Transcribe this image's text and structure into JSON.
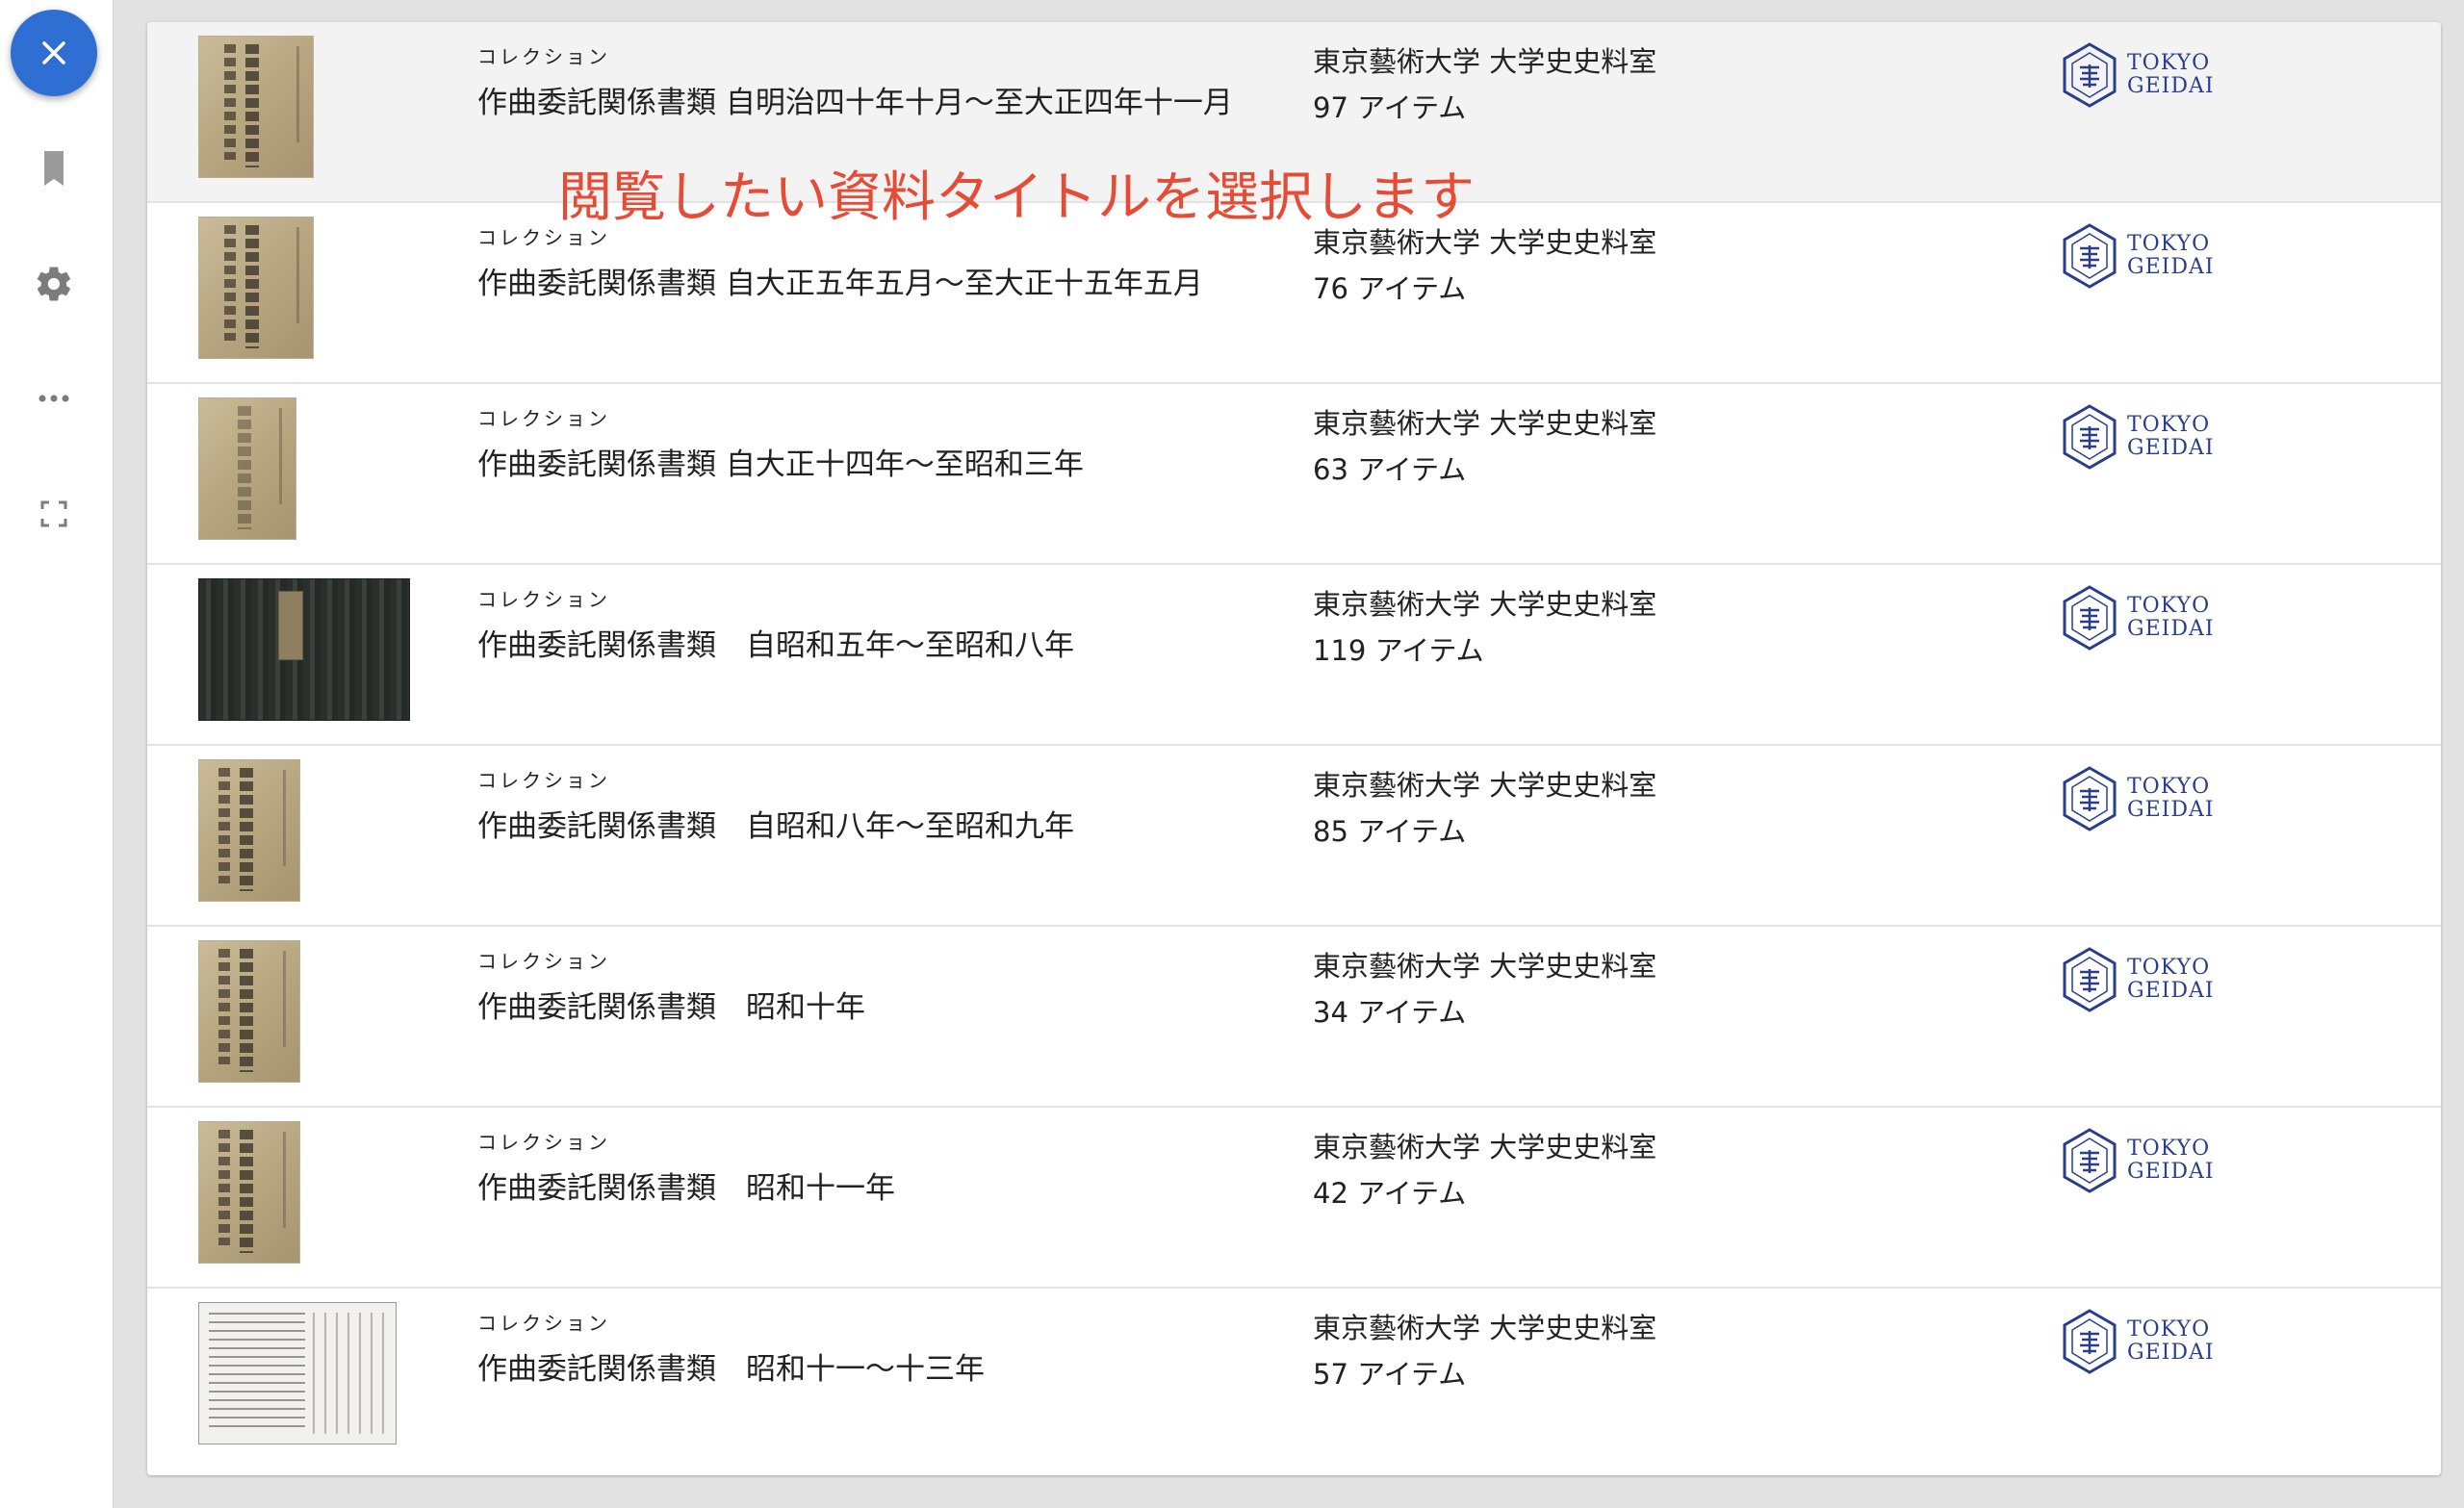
{
  "sidebar": {
    "close_icon": "close-icon",
    "items": [
      {
        "icon": "bookmark-icon"
      },
      {
        "icon": "gear-icon"
      },
      {
        "icon": "more-icon"
      },
      {
        "icon": "fullscreen-icon"
      }
    ]
  },
  "annotation": "閲覧したい資料タイトルを選択します",
  "colors": {
    "accent": "#2f6ed3",
    "annotation": "#e54b35",
    "logo": "#2b3e8c"
  },
  "results": [
    {
      "kind": "コレクション",
      "title": "作曲委託関係書類 自明治四十年十月〜至大正四年十一月",
      "holder": "東京藝術大学 大学史史料室",
      "count": "97 アイテム",
      "logo_l1": "TOKYO",
      "logo_l2": "GEIDAI"
    },
    {
      "kind": "コレクション",
      "title": "作曲委託関係書類 自大正五年五月〜至大正十五年五月",
      "holder": "東京藝術大学 大学史史料室",
      "count": "76 アイテム",
      "logo_l1": "TOKYO",
      "logo_l2": "GEIDAI"
    },
    {
      "kind": "コレクション",
      "title": "作曲委託関係書類 自大正十四年〜至昭和三年",
      "holder": "東京藝術大学 大学史史料室",
      "count": "63 アイテム",
      "logo_l1": "TOKYO",
      "logo_l2": "GEIDAI"
    },
    {
      "kind": "コレクション",
      "title": "作曲委託関係書類　自昭和五年〜至昭和八年",
      "holder": "東京藝術大学 大学史史料室",
      "count": "119 アイテム",
      "logo_l1": "TOKYO",
      "logo_l2": "GEIDAI"
    },
    {
      "kind": "コレクション",
      "title": "作曲委託関係書類　自昭和八年〜至昭和九年",
      "holder": "東京藝術大学 大学史史料室",
      "count": "85 アイテム",
      "logo_l1": "TOKYO",
      "logo_l2": "GEIDAI"
    },
    {
      "kind": "コレクション",
      "title": "作曲委託関係書類　昭和十年",
      "holder": "東京藝術大学 大学史史料室",
      "count": "34 アイテム",
      "logo_l1": "TOKYO",
      "logo_l2": "GEIDAI"
    },
    {
      "kind": "コレクション",
      "title": "作曲委託関係書類　昭和十一年",
      "holder": "東京藝術大学 大学史史料室",
      "count": "42 アイテム",
      "logo_l1": "TOKYO",
      "logo_l2": "GEIDAI"
    },
    {
      "kind": "コレクション",
      "title": "作曲委託関係書類　昭和十一〜十三年",
      "holder": "東京藝術大学 大学史史料室",
      "count": "57 アイテム",
      "logo_l1": "TOKYO",
      "logo_l2": "GEIDAI"
    }
  ]
}
